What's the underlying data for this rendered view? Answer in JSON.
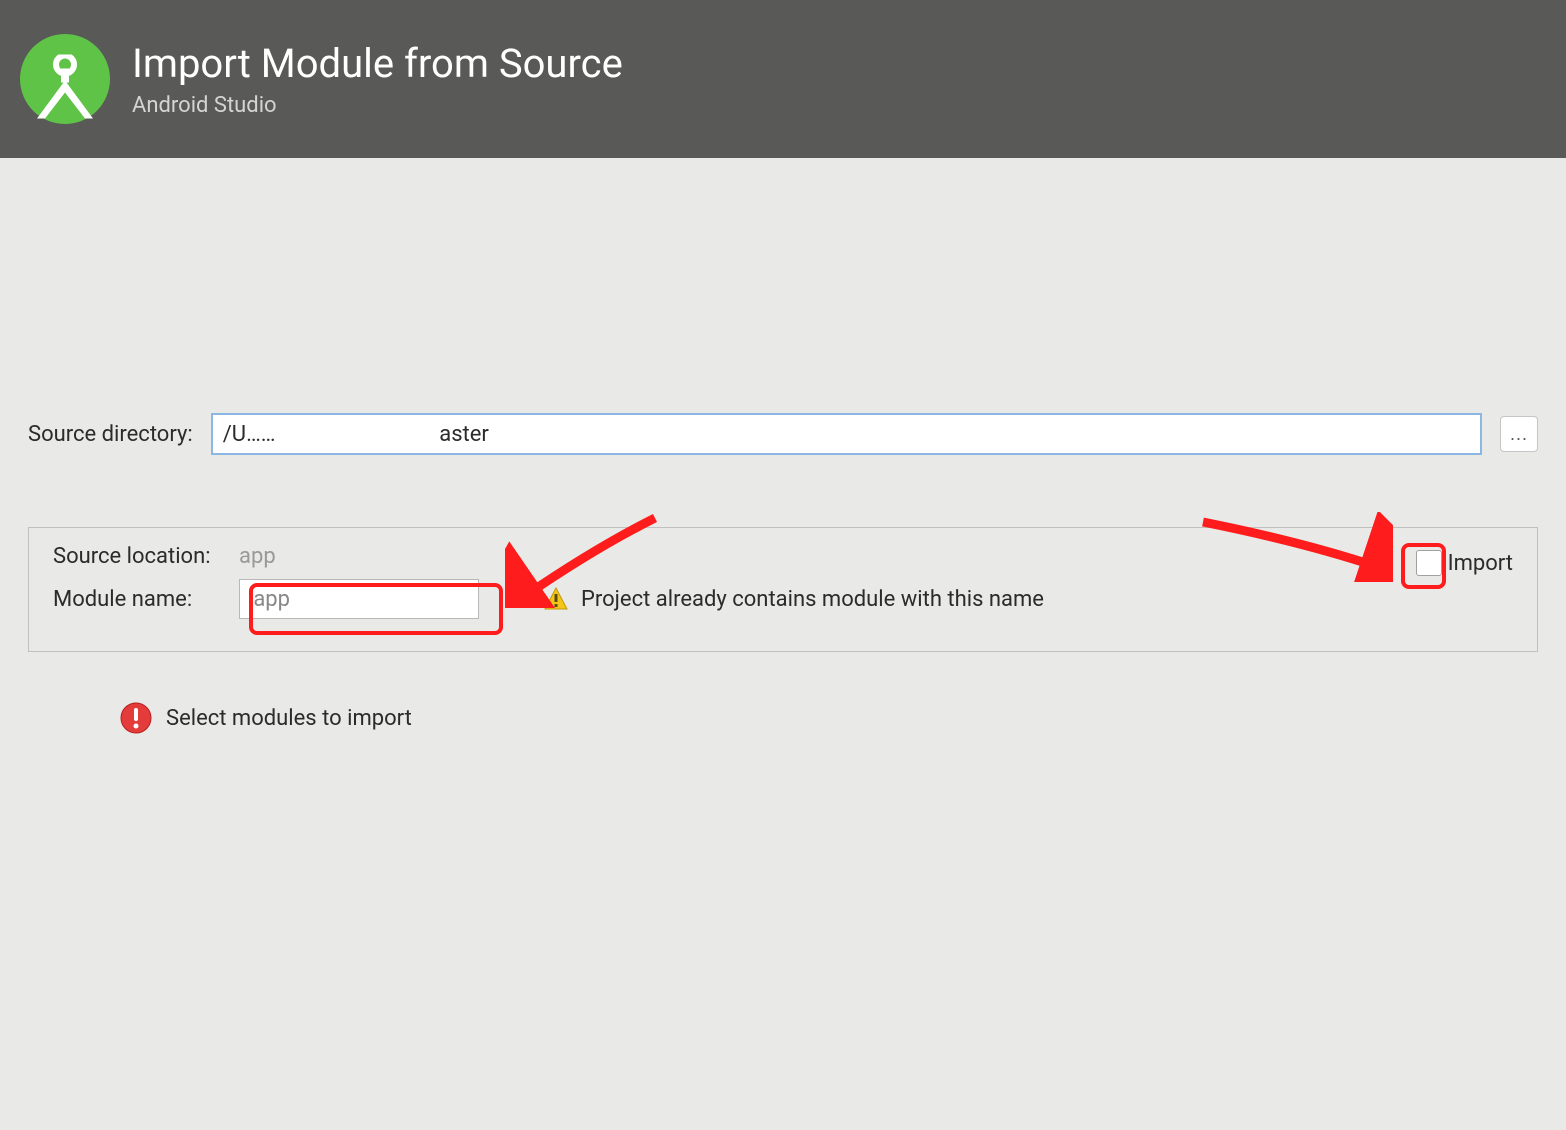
{
  "header": {
    "title": "Import Module from Source",
    "subtitle": "Android Studio"
  },
  "form": {
    "source_directory_label": "Source directory:",
    "source_directory_value": "/U……                              aster",
    "browse_button": "...",
    "source_location_label": "Source location:",
    "source_location_value": "app",
    "module_name_label": "Module name:",
    "module_name_value": ":app",
    "warning_message": "Project already contains module with this name",
    "import_checkbox_label": "Import",
    "import_checked": false
  },
  "error": {
    "message": "Select modules to import"
  }
}
